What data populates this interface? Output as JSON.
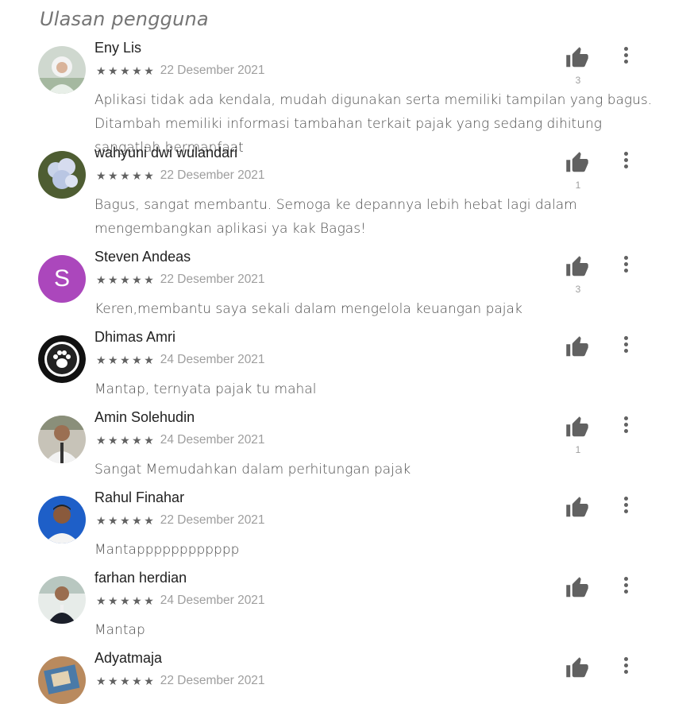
{
  "section_title": "Ulasan pengguna",
  "reviews": [
    {
      "name": "Eny Lis",
      "stars": "★★★★★",
      "date": "22 Desember 2021",
      "likes": "3",
      "text": "Aplikasi tidak ada kendala, mudah digunakan serta memiliki tampilan yang bagus. Ditambah memiliki informasi tambahan terkait pajak yang sedang dihitung sangatlah bermanfaat"
    },
    {
      "name": "wahyuni dwi wulandari",
      "stars": "★★★★★",
      "date": "22 Desember 2021",
      "likes": "1",
      "text": "Bagus, sangat membantu. Semoga ke depannya lebih hebat lagi dalam mengembangkan aplikasi ya kak Bagas!"
    },
    {
      "name": "Steven Andeas",
      "stars": "★★★★★",
      "date": "22 Desember 2021",
      "likes": "3",
      "avatar_letter": "S",
      "text": "Keren,membantu saya sekali dalam mengelola keuangan pajak"
    },
    {
      "name": "Dhimas Amri",
      "stars": "★★★★★",
      "date": "24 Desember 2021",
      "likes": "",
      "text": "Mantap, ternyata pajak tu mahal"
    },
    {
      "name": "Amin Solehudin",
      "stars": "★★★★★",
      "date": "24 Desember 2021",
      "likes": "1",
      "text": "Sangat Memudahkan dalam perhitungan pajak"
    },
    {
      "name": "Rahul Finahar",
      "stars": "★★★★★",
      "date": "22 Desember 2021",
      "likes": "",
      "text": "Mantapppppppppppp"
    },
    {
      "name": "farhan herdian",
      "stars": "★★★★★",
      "date": "24 Desember 2021",
      "likes": "",
      "text": "Mantap"
    },
    {
      "name": "Adyatmaja",
      "stars": "★★★★★",
      "date": "22 Desember 2021",
      "likes": "",
      "text": ""
    }
  ],
  "colors": {
    "avatar_purple": "#ab47bc",
    "icon_gray": "#616161"
  }
}
